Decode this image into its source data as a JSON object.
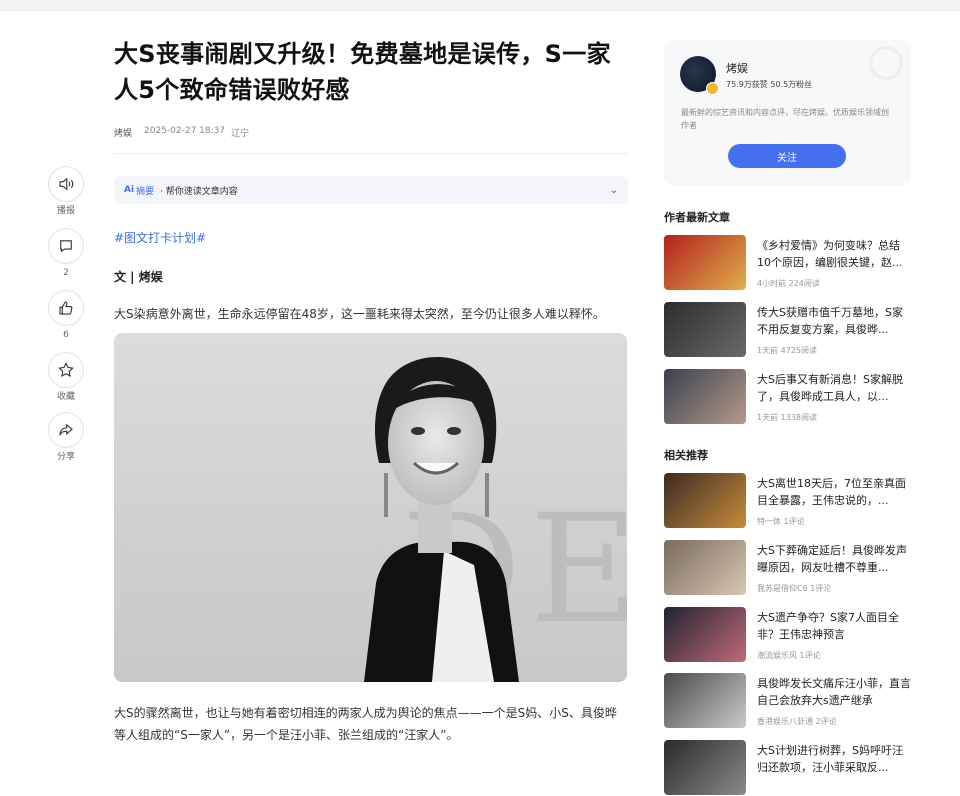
{
  "article": {
    "title": "大S丧事闹剧又升级！免费墓地是误传，S一家人5个致命错误败好感",
    "author": "烤娱",
    "date": "2025-02-27 18:37",
    "location": "辽宁",
    "summary_ai": "Ai",
    "summary_word": "摘要",
    "summary_text": "· 帮你速读文章内容",
    "hashtag": "#图文打卡计划#",
    "byline": "文 | 烤娱",
    "para1": "大S染病意外离世，生命永远停留在48岁，这一噩耗来得太突然，至今仍让很多人难以释怀。",
    "para2": "大S的骤然离世，也让与她有着密切相连的两家人成为舆论的焦点——一个是S妈、小S、具俊晔等人组成的“S一家人”，另一个是汪小菲、张兰组成的“汪家人”。",
    "photo_bg_text": "DE"
  },
  "actions": [
    {
      "label": "播报",
      "icon": "speaker-icon"
    },
    {
      "label": "2",
      "icon": "comment-icon"
    },
    {
      "label": "6",
      "icon": "thumbs-up-icon"
    },
    {
      "label": "收藏",
      "icon": "star-icon"
    },
    {
      "label": "分享",
      "icon": "share-icon"
    }
  ],
  "author_card": {
    "name": "烤娱",
    "stats": "75.9万获赞 50.5万粉丝",
    "desc": "最新鲜的综艺资讯和内容点评，尽在烤娱。优质娱乐领域创作者",
    "follow_label": "关注"
  },
  "latest": {
    "heading": "作者最新文章",
    "items": [
      {
        "title": "《乡村爱情》为何变味？总结10个原因，编剧很关键，赵...",
        "meta": "4小时前  224阅读",
        "thumb": [
          "#b2201f",
          "#e0b04a"
        ]
      },
      {
        "title": "传大S获赠市值千万墓地，S家不用反复变方案，具俊晔...",
        "meta": "1天前  4725阅读",
        "thumb": [
          "#2c2c2c",
          "#6a6a6a"
        ]
      },
      {
        "title": "大S后事又有新消息！S家解脱了，具俊晔成工具人，以...",
        "meta": "1天前  1338阅读",
        "thumb": [
          "#3a3f52",
          "#b59a8a"
        ]
      }
    ]
  },
  "related": {
    "heading": "相关推荐",
    "items": [
      {
        "title": "大S离世18天后，7位至亲真面目全暴露，王伟忠说的，...",
        "meta": "特一体  1评论",
        "thumb": [
          "#3b2c22",
          "#c88b3a"
        ]
      },
      {
        "title": "大S下葬确定延后！具俊晔发声曝原因，网友吐槽不尊重...",
        "meta": "我苏是借仰C6  1评论",
        "thumb": [
          "#7a6a5a",
          "#d8c7b4"
        ]
      },
      {
        "title": "大S遗产争夺？S家7人面目全非？王伟忠神预言",
        "meta": "潮流娱乐风  1评论",
        "thumb": [
          "#202430",
          "#c06a7a"
        ]
      },
      {
        "title": "具俊晔发长文痛斥汪小菲，直言自己会放弃大s遗产继承",
        "meta": "香港娱乐八卦通  2评论",
        "thumb": [
          "#4a4a4a",
          "#c9c9c9"
        ]
      },
      {
        "title": "大S计划进行树葬，S妈呼吁汪归还款项，汪小菲采取反...",
        "meta": "",
        "thumb": [
          "#2a2a2a",
          "#8a8a8a"
        ]
      }
    ]
  }
}
